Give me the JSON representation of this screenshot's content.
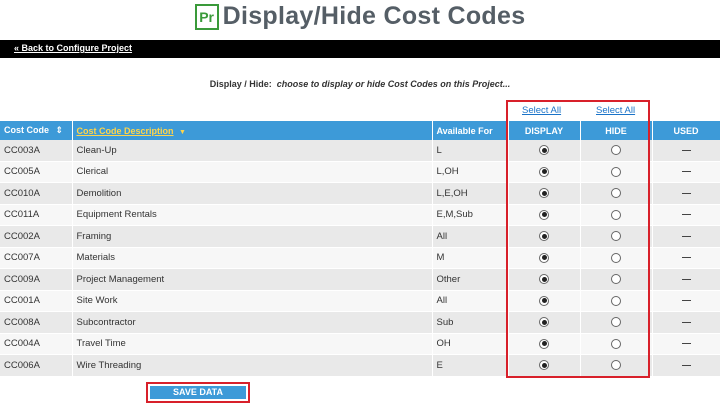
{
  "header": {
    "logo_text": "Pr",
    "title": "Display/Hide Cost Codes",
    "back_link": "« Back to Configure Project"
  },
  "instruction": {
    "label": "Display / Hide:",
    "text": "choose to display or hide Cost Codes on this Project..."
  },
  "select_all": {
    "display": "Select All",
    "hide": "Select All"
  },
  "table": {
    "columns": {
      "code": "Cost Code",
      "description": "Cost Code Description",
      "available": "Available For",
      "display": "DISPLAY",
      "hide": "HIDE",
      "used": "USED"
    },
    "rows": [
      {
        "code": "CC003A",
        "description": "Clean-Up",
        "available": "L",
        "display": true
      },
      {
        "code": "CC005A",
        "description": "Clerical",
        "available": "L,OH",
        "display": true
      },
      {
        "code": "CC010A",
        "description": "Demolition",
        "available": "L,E,OH",
        "display": true
      },
      {
        "code": "CC011A",
        "description": "Equipment Rentals",
        "available": "E,M,Sub",
        "display": true
      },
      {
        "code": "CC002A",
        "description": "Framing",
        "available": "All",
        "display": true
      },
      {
        "code": "CC007A",
        "description": "Materials",
        "available": "M",
        "display": true
      },
      {
        "code": "CC009A",
        "description": "Project Management",
        "available": "Other",
        "display": true
      },
      {
        "code": "CC001A",
        "description": "Site Work",
        "available": "All",
        "display": true
      },
      {
        "code": "CC008A",
        "description": "Subcontractor",
        "available": "Sub",
        "display": true
      },
      {
        "code": "CC004A",
        "description": "Travel Time",
        "available": "OH",
        "display": true
      },
      {
        "code": "CC006A",
        "description": "Wire Threading",
        "available": "E",
        "display": true
      }
    ]
  },
  "save_button": "SAVE DATA",
  "colors": {
    "header_blue": "#3d9ad8",
    "sort_link": "#ffd54a",
    "highlight_red": "#d8202a",
    "logo_green": "#3a9a3a"
  }
}
